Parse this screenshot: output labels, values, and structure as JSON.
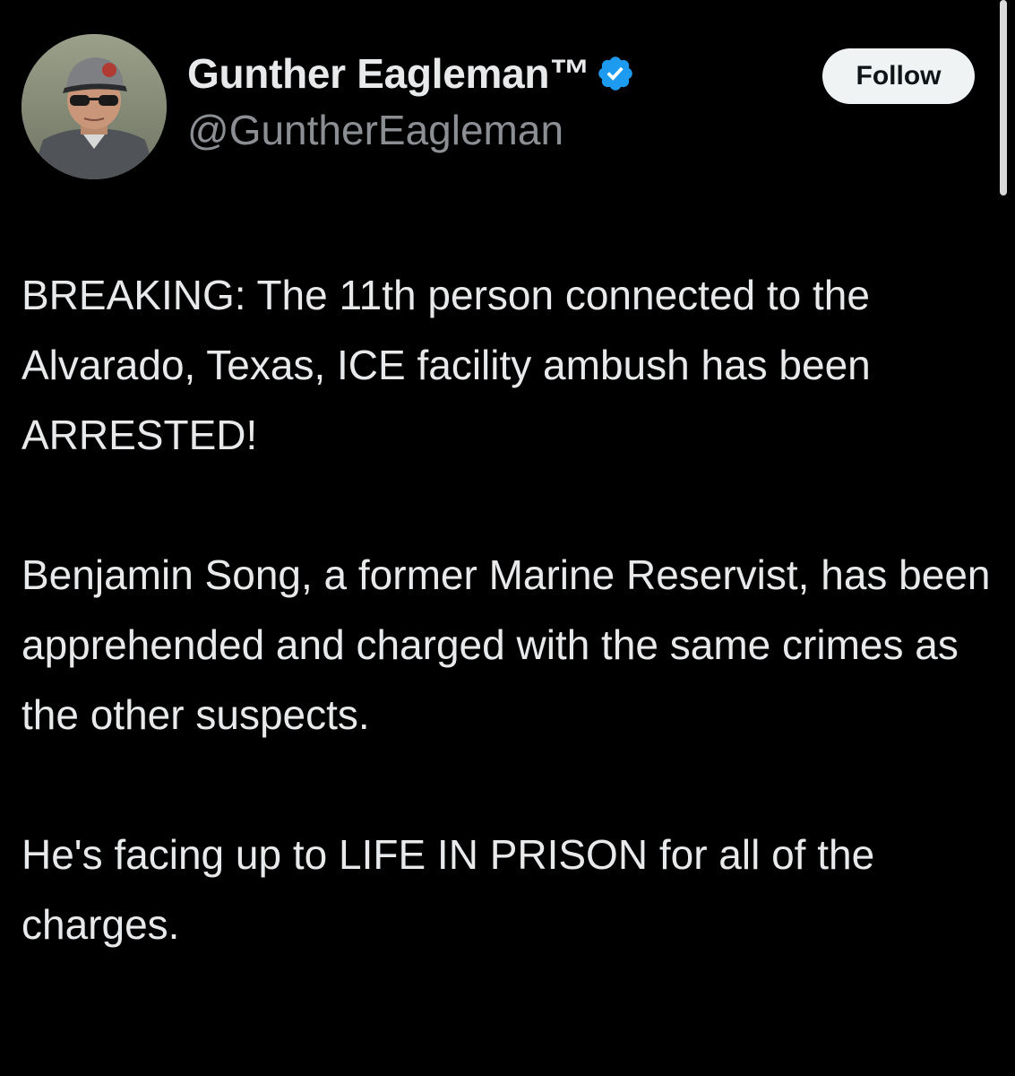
{
  "author": {
    "display_name": "Gunther Eagleman™",
    "handle": "@GuntherEagleman",
    "verified": true,
    "verified_color": "#1d9bf0",
    "avatar_icon": "profile-photo-man-cap-sunglasses"
  },
  "actions": {
    "follow_label": "Follow"
  },
  "tweet": {
    "paragraphs": [
      "BREAKING: The 11th person connected to the Alvarado, Texas, ICE facility ambush has been ARRESTED!",
      "Benjamin Song, a former Marine Reservist, has been apprehended and charged with the same crimes as the other suspects.",
      "He's facing up to LIFE IN PRISON for all of the charges."
    ]
  },
  "colors": {
    "background": "#000000",
    "text": "#e7e9ea",
    "secondary_text": "#8b8f94",
    "button_bg": "#eff3f4"
  }
}
